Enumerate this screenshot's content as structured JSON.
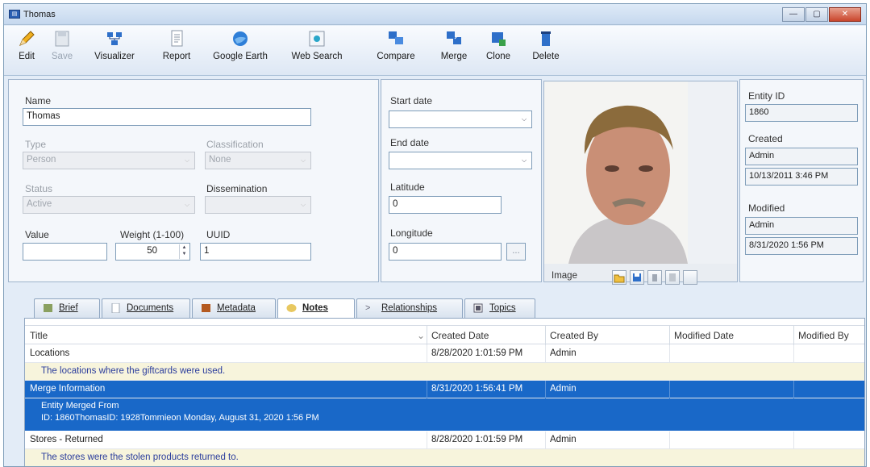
{
  "window": {
    "title": "Thomas",
    "min": "—",
    "max": "▢",
    "close": "✕"
  },
  "toolbar": {
    "edit": "Edit",
    "save": "Save",
    "visualizer": "Visualizer",
    "report": "Report",
    "google_earth": "Google Earth",
    "web_search": "Web Search",
    "compare": "Compare",
    "merge": "Merge",
    "clone": "Clone",
    "delete": "Delete"
  },
  "form": {
    "name_label": "Name",
    "name_value": "Thomas",
    "type_label": "Type",
    "type_value": "Person",
    "classification_label": "Classification",
    "classification_value": "None",
    "status_label": "Status",
    "status_value": "Active",
    "dissemination_label": "Dissemination",
    "dissemination_value": "",
    "value_label": "Value",
    "value_value": "",
    "weight_label": "Weight (1-100)",
    "weight_value": "50",
    "uuid_label": "UUID",
    "uuid_value": "1",
    "start_date_label": "Start date",
    "start_date_value": "",
    "end_date_label": "End date",
    "end_date_value": "",
    "latitude_label": "Latitude",
    "latitude_value": "0",
    "longitude_label": "Longitude",
    "longitude_value": "0",
    "browse": "...",
    "image_label": "Image"
  },
  "meta": {
    "entity_id_label": "Entity ID",
    "entity_id": "1860",
    "created_label": "Created",
    "created_by": "Admin",
    "created_at": "10/13/2011 3:46 PM",
    "modified_label": "Modified",
    "modified_by": "Admin",
    "modified_at": "8/31/2020 1:56 PM"
  },
  "tabs": [
    {
      "label": "Brief"
    },
    {
      "label": "Documents"
    },
    {
      "label": "Metadata"
    },
    {
      "label": "Notes"
    },
    {
      "label": "Relationships"
    },
    {
      "label": "Topics"
    }
  ],
  "grid": {
    "columns": [
      "Title",
      "Created Date",
      "Created By",
      "Modified Date",
      "Modified By"
    ],
    "sort_indicator": "⌄",
    "rows": [
      {
        "title": "Locations",
        "created_date": "8/28/2020 1:01:59 PM",
        "created_by": "Admin",
        "modified_date": "",
        "modified_by": "",
        "desc": [
          "The locations where the giftcards were used."
        ]
      },
      {
        "title": "Merge Information",
        "created_date": "8/31/2020 1:56:41 PM",
        "created_by": "Admin",
        "modified_date": "",
        "modified_by": "",
        "desc": [
          "Entity Merged From",
          "ID: 1860ThomasID: 1928Tommieon Monday, August 31, 2020 1:56 PM"
        ]
      },
      {
        "title": "Stores - Returned",
        "created_date": "8/28/2020 1:01:59 PM",
        "created_by": "Admin",
        "modified_date": "",
        "modified_by": "",
        "desc": [
          "The stores were the stolen products returned to."
        ]
      }
    ]
  }
}
